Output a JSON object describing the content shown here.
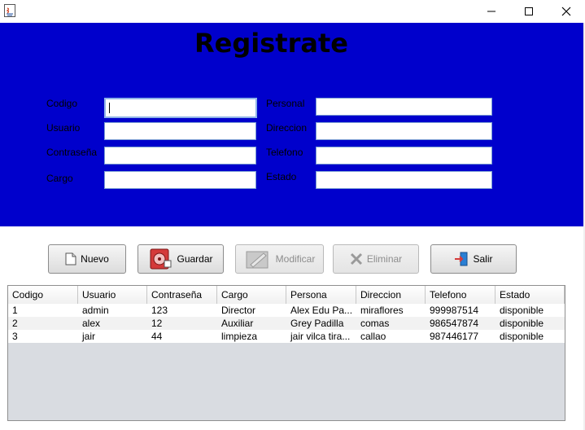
{
  "window": {
    "title": "",
    "minimize_icon": "minimize-icon",
    "maximize_icon": "maximize-icon",
    "close_icon": "close-icon"
  },
  "header": {
    "title": "Registrate",
    "background": "#0000cc"
  },
  "form": {
    "left": [
      {
        "label": "Codigo",
        "value": ""
      },
      {
        "label": "Usuario",
        "value": ""
      },
      {
        "label": "Contraseña",
        "value": ""
      },
      {
        "label": "Cargo",
        "value": ""
      }
    ],
    "right": [
      {
        "label": "Personal",
        "value": ""
      },
      {
        "label": "Direccion",
        "value": ""
      },
      {
        "label": "Telefono",
        "value": ""
      },
      {
        "label": "Estado",
        "value": ""
      }
    ]
  },
  "buttons": {
    "nuevo": "Nuevo",
    "guardar": "Guardar",
    "modificar": "Modificar",
    "eliminar": "Eliminar",
    "salir": "Salir"
  },
  "table": {
    "columns": [
      "Codigo",
      "Usuario",
      "Contraseña",
      "Cargo",
      "Persona",
      "Direccion",
      "Telefono",
      "Estado"
    ],
    "rows": [
      [
        "1",
        "admin",
        "123",
        "Director",
        "Alex Edu Pa...",
        "miraflores",
        "999987514",
        "disponible"
      ],
      [
        "2",
        "alex",
        "12",
        "Auxiliar",
        "Grey Padilla",
        "comas",
        "986547874",
        "disponible"
      ],
      [
        "3",
        "jair",
        "44",
        "limpieza",
        "jair vilca tira...",
        "callao",
        "987446177",
        "disponible"
      ]
    ]
  }
}
